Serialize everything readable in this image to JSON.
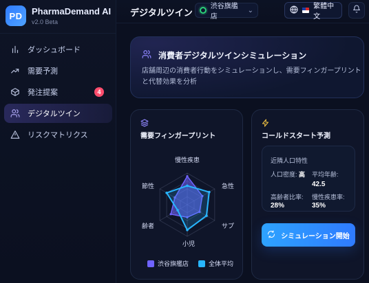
{
  "app": {
    "logo_text": "PD",
    "name": "PharmaDemand AI",
    "version": "v2.0 Beta"
  },
  "sidebar": {
    "items": [
      {
        "label": "ダッシュボード",
        "icon": "bar-chart-icon"
      },
      {
        "label": "需要予測",
        "icon": "trend-up-icon"
      },
      {
        "label": "発注提案",
        "icon": "package-icon",
        "badge": "4"
      },
      {
        "label": "デジタルツイン",
        "icon": "users-icon",
        "active": true
      },
      {
        "label": "リスクマトリクス",
        "icon": "warning-icon"
      }
    ]
  },
  "header": {
    "title": "デジタルツイン",
    "store_select": {
      "value": "渋谷旗艦店"
    },
    "language_button": {
      "label": "繁體中文"
    }
  },
  "hero": {
    "title": "消費者デジタルツインシミュレーション",
    "description": "店舗周辺の消費者行動をシミュレーションし、需要フィンガープリントと代替効果を分析"
  },
  "fingerprint_card": {
    "title": "需要フィンガープリント",
    "axes": {
      "top": "慢性疾患",
      "left_top": "節性",
      "right_top": "急性",
      "left_bottom": "齢者",
      "right_bottom": "サプ",
      "bottom": "小児"
    },
    "legend": [
      {
        "name": "渋谷旗艦店",
        "color": "#6f63ff"
      },
      {
        "name": "全体平均",
        "color": "#28b6ff"
      }
    ]
  },
  "coldstart_card": {
    "title": "コールドスタート予測",
    "demographics_title": "近隣人口特性",
    "population_density_label": "人口密度:",
    "population_density_value": "高",
    "average_age_label": "平均年齢:",
    "average_age_value": "42.5",
    "elderly_ratio_label": "高齢者比率:",
    "elderly_ratio_value": "28%",
    "chronic_rate_label": "慢性疾患率:",
    "chronic_rate_value": "35%",
    "simulate_button": "シミュレーション開始"
  },
  "chart_data": {
    "type": "radar",
    "axes": [
      "慢性疾患",
      "急性",
      "サプ",
      "小児",
      "齢者",
      "節性"
    ],
    "series": [
      {
        "name": "渋谷旗艦店",
        "values": [
          0.9,
          0.55,
          0.45,
          0.4,
          0.6,
          0.45
        ]
      },
      {
        "name": "全体平均",
        "values": [
          0.6,
          0.8,
          0.7,
          0.8,
          0.35,
          0.75
        ]
      }
    ],
    "legend_position": "bottom"
  }
}
